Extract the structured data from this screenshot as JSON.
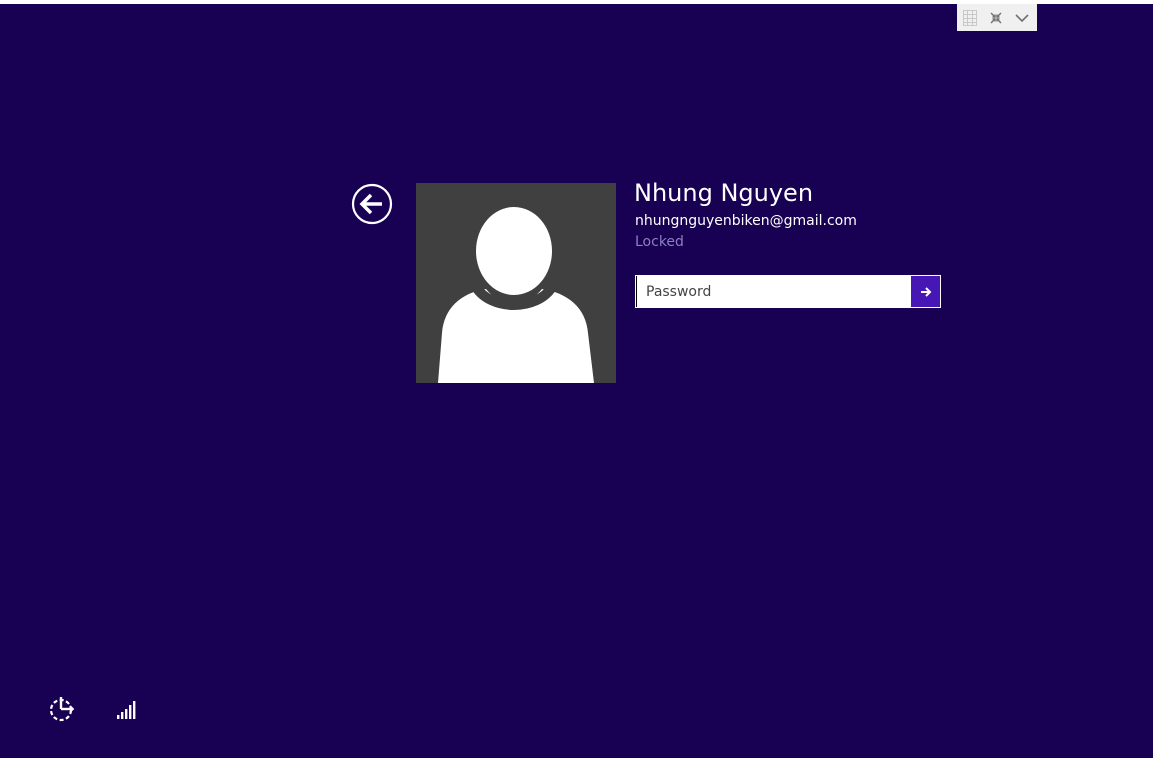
{
  "toolbar": {
    "icons": [
      "grid-icon",
      "collapse-icon",
      "chevron-down-icon"
    ]
  },
  "login": {
    "user_name": "Nhung Nguyen",
    "email": "nhungnguyenbiken@gmail.com",
    "status": "Locked",
    "password_placeholder": "Password",
    "password_value": ""
  },
  "bottom": {
    "icons": [
      "ease-of-access-icon",
      "network-signal-icon"
    ]
  },
  "colors": {
    "background": "#180052",
    "submit_accent": "#4617b4",
    "status_text": "#8d7fc1",
    "avatar_tile": "#404040"
  }
}
